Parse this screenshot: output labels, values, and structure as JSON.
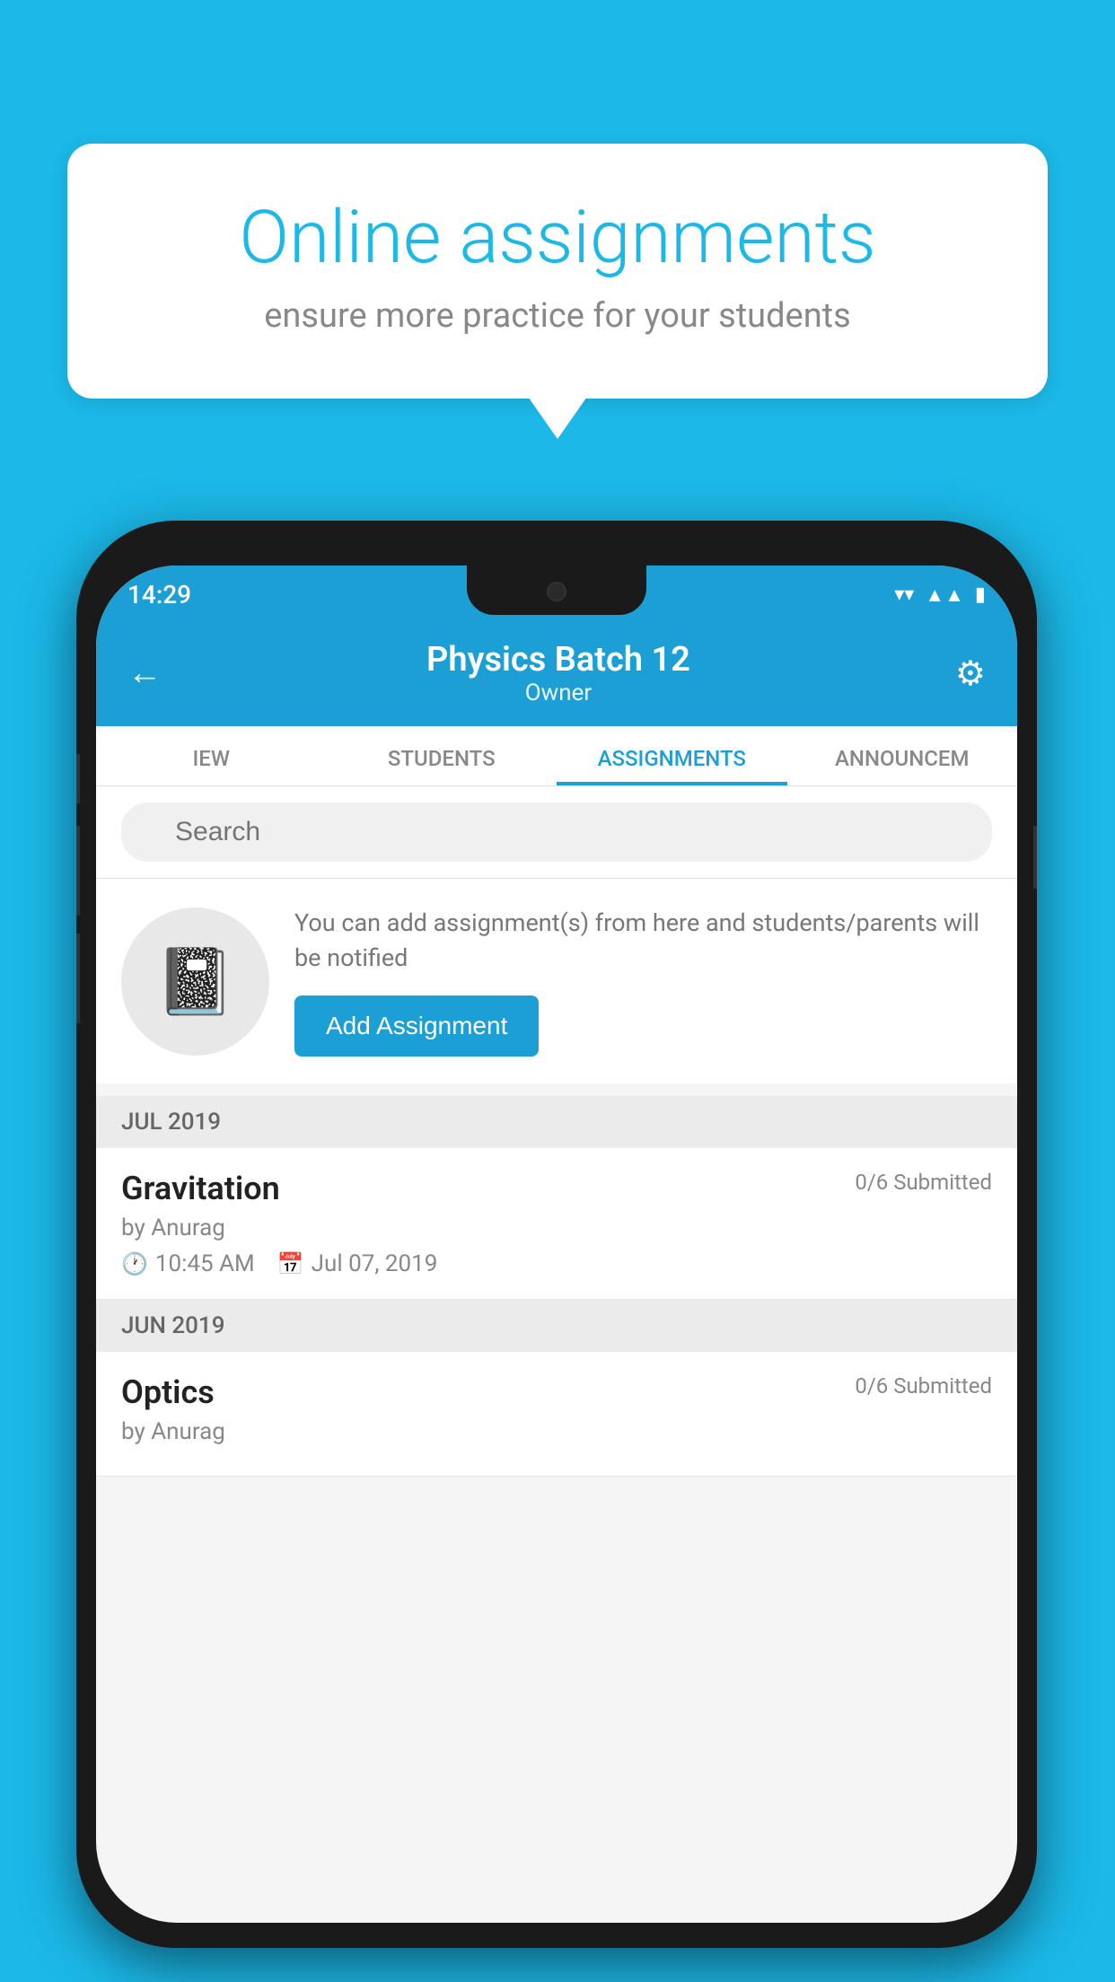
{
  "background": {
    "color": "#1BB8E8"
  },
  "speech_bubble": {
    "title": "Online assignments",
    "subtitle": "ensure more practice for your students"
  },
  "status_bar": {
    "time": "14:29",
    "wifi": "▼",
    "signal": "▲",
    "battery": "▮"
  },
  "header": {
    "back_label": "←",
    "title": "Physics Batch 12",
    "subtitle": "Owner",
    "gear_label": "⚙"
  },
  "tabs": [
    {
      "label": "IEW",
      "active": false
    },
    {
      "label": "STUDENTS",
      "active": false
    },
    {
      "label": "ASSIGNMENTS",
      "active": true
    },
    {
      "label": "ANNOUNCEM",
      "active": false
    }
  ],
  "search": {
    "placeholder": "Search"
  },
  "add_assignment_card": {
    "description": "You can add assignment(s) from here and students/parents will be notified",
    "button_label": "Add Assignment"
  },
  "sections": [
    {
      "month": "JUL 2019",
      "items": [
        {
          "name": "Gravitation",
          "submitted": "0/6 Submitted",
          "by": "by Anurag",
          "time": "10:45 AM",
          "date": "Jul 07, 2019"
        }
      ]
    },
    {
      "month": "JUN 2019",
      "items": [
        {
          "name": "Optics",
          "submitted": "0/6 Submitted",
          "by": "by Anurag",
          "time": "",
          "date": ""
        }
      ]
    }
  ]
}
